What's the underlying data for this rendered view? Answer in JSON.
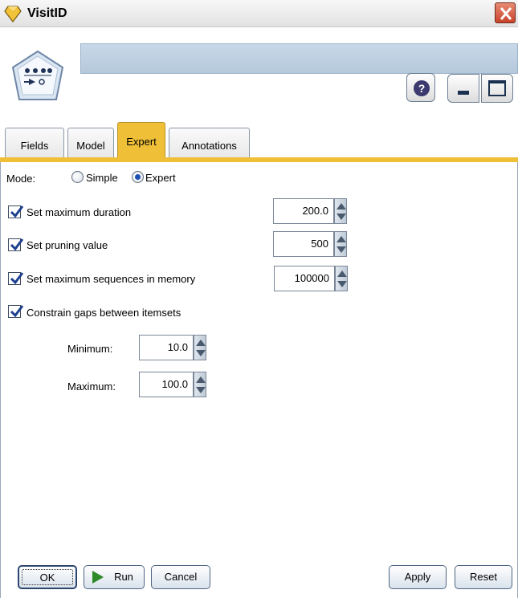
{
  "window": {
    "title": "VisitID",
    "close_icon": "close-icon",
    "node_icon": "sequence-node-icon"
  },
  "header": {
    "help_label": "?",
    "help_icon": "help-icon",
    "minimize_icon": "minimize-icon",
    "maximize_icon": "maximize-icon"
  },
  "tabs": [
    {
      "label": "Fields",
      "active": false
    },
    {
      "label": "Model",
      "active": false
    },
    {
      "label": "Expert",
      "active": true
    },
    {
      "label": "Annotations",
      "active": false
    }
  ],
  "expert": {
    "mode_label": "Mode:",
    "mode_options": [
      {
        "label": "Simple",
        "selected": false
      },
      {
        "label": "Expert",
        "selected": true
      }
    ],
    "settings": [
      {
        "label": "Set maximum duration",
        "checked": true,
        "value": "200.0"
      },
      {
        "label": "Set pruning value",
        "checked": true,
        "value": "500"
      },
      {
        "label": "Set maximum sequences in memory",
        "checked": true,
        "value": "100000"
      }
    ],
    "constrain_gaps": {
      "label": "Constrain gaps between itemsets",
      "checked": true,
      "minimum_label": "Minimum:",
      "minimum_value": "10.0",
      "maximum_label": "Maximum:",
      "maximum_value": "100.0"
    }
  },
  "buttons": {
    "ok": "OK",
    "run": "Run",
    "cancel": "Cancel",
    "apply": "Apply",
    "reset": "Reset"
  },
  "colors": {
    "active_tab": "#efbf38",
    "header_bar": "#c8d8e8",
    "checkmark": "#1d3f8f",
    "close_button": "#c9432a",
    "run_icon": "#2f8a2b"
  }
}
